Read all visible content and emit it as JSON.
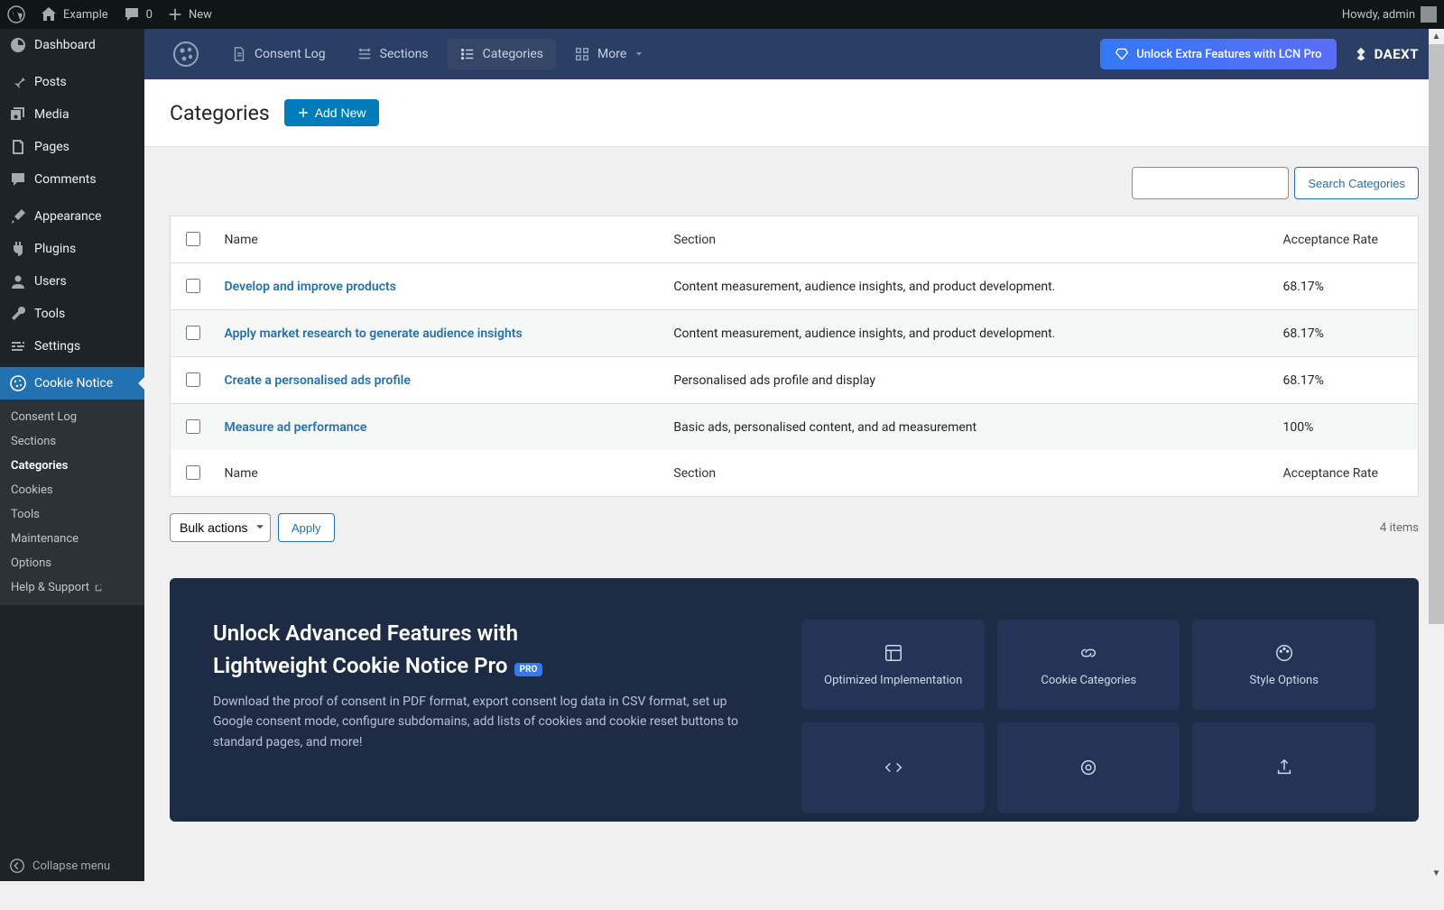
{
  "adminbar": {
    "site_name": "Example",
    "comments": "0",
    "new_label": "New",
    "howdy": "Howdy, admin"
  },
  "adminmenu": {
    "items": [
      {
        "id": "dashboard",
        "label": "Dashboard"
      },
      {
        "id": "posts",
        "label": "Posts"
      },
      {
        "id": "media",
        "label": "Media"
      },
      {
        "id": "pages",
        "label": "Pages"
      },
      {
        "id": "comments",
        "label": "Comments"
      },
      {
        "id": "appearance",
        "label": "Appearance"
      },
      {
        "id": "plugins",
        "label": "Plugins"
      },
      {
        "id": "users",
        "label": "Users"
      },
      {
        "id": "tools",
        "label": "Tools"
      },
      {
        "id": "settings",
        "label": "Settings"
      },
      {
        "id": "cookie-notice",
        "label": "Cookie Notice"
      }
    ],
    "submenu": [
      {
        "label": "Consent Log"
      },
      {
        "label": "Sections"
      },
      {
        "label": "Categories"
      },
      {
        "label": "Cookies"
      },
      {
        "label": "Tools"
      },
      {
        "label": "Maintenance"
      },
      {
        "label": "Options"
      },
      {
        "label": "Help & Support"
      }
    ],
    "collapse": "Collapse menu"
  },
  "plugin_nav": {
    "items": [
      {
        "label": "Consent Log"
      },
      {
        "label": "Sections"
      },
      {
        "label": "Categories"
      },
      {
        "label": "More"
      }
    ],
    "unlock": "Unlock Extra Features with LCN Pro",
    "brand": "DAEXT"
  },
  "page": {
    "title": "Categories",
    "add_new": "Add New",
    "search_btn": "Search Categories",
    "columns": {
      "name": "Name",
      "section": "Section",
      "rate": "Acceptance Rate"
    },
    "rows": [
      {
        "name": "Develop and improve products",
        "section": "Content measurement, audience insights, and product development.",
        "rate": "68.17%"
      },
      {
        "name": "Apply market research to generate audience insights",
        "section": "Content measurement, audience insights, and product development.",
        "rate": "68.17%"
      },
      {
        "name": "Create a personalised ads profile",
        "section": "Personalised ads profile and display",
        "rate": "68.17%"
      },
      {
        "name": "Measure ad performance",
        "section": "Basic ads, personalised content, and ad measurement",
        "rate": "100%"
      }
    ],
    "bulk_actions": "Bulk actions",
    "apply": "Apply",
    "items_count": "4 items"
  },
  "promo": {
    "title_l1": "Unlock Advanced Features with",
    "title_l2": "Lightweight Cookie Notice Pro",
    "badge": "PRO",
    "desc": "Download the proof of consent in PDF format, export consent log data in CSV format, set up Google consent mode, configure subdomains, add lists of cookies and cookie reset buttons to standard pages, and more!",
    "tiles": [
      "Optimized Implementation",
      "Cookie Categories",
      "Style Options"
    ]
  }
}
